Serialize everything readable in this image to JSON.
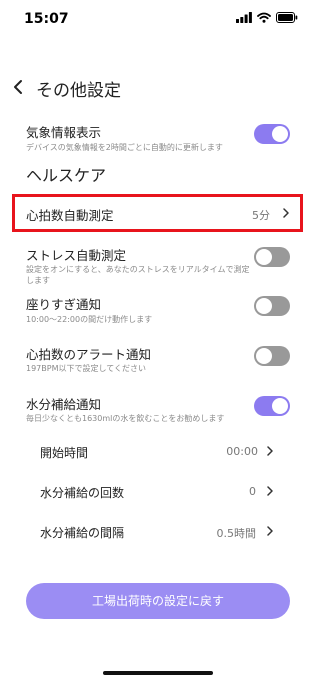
{
  "status": {
    "time": "15:07"
  },
  "header": {
    "title": "その他設定"
  },
  "weather": {
    "title": "気象情報表示",
    "desc": "デバイスの気象情報を2時間ごとに自動的に更新します",
    "on": true
  },
  "section": {
    "health": "ヘルスケア"
  },
  "heart_rate_auto": {
    "title": "心拍数自動測定",
    "value": "5分"
  },
  "stress": {
    "title": "ストレス自動測定",
    "desc": "設定をオンにすると、あなたのストレスをリアルタイムで測定します",
    "on": false
  },
  "sedentary": {
    "title": "座りすぎ通知",
    "desc": "10:00～22:00の間だけ動作します",
    "on": false
  },
  "hr_alert": {
    "title": "心拍数のアラート通知",
    "desc": "197BPM以下で設定してください",
    "on": false
  },
  "hydration": {
    "title": "水分補給通知",
    "desc": "毎日少なくとも1630mlの水を飲むことをお勧めします",
    "on": true,
    "start_label": "開始時間",
    "start_value": "00:00",
    "count_label": "水分補給の回数",
    "count_value": "0",
    "interval_label": "水分補給の間隔",
    "interval_value": "0.5時間"
  },
  "reset": {
    "label": "工場出荷時の設定に戻す"
  },
  "colors": {
    "accent": "#8c7bf0",
    "highlight": "#e8141c",
    "toggle_off": "#999999"
  },
  "icons": [
    "signal-icon",
    "wifi-icon",
    "battery-icon",
    "back-chevron-icon",
    "chevron-right-icon"
  ]
}
